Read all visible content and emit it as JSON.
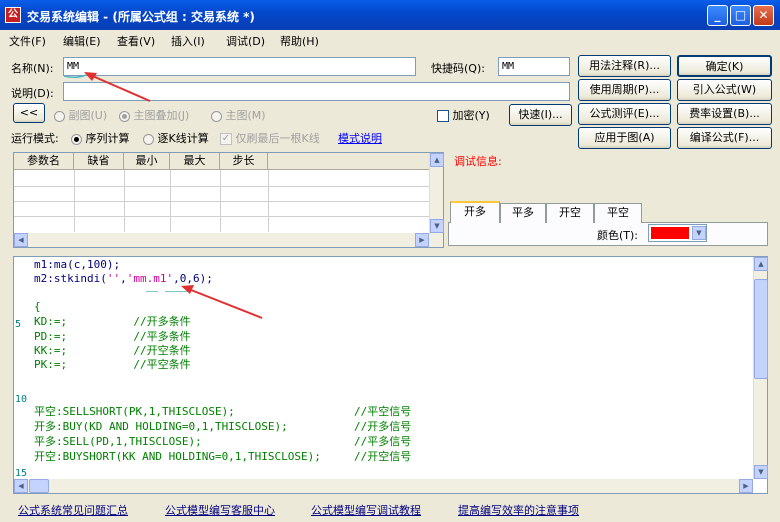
{
  "window": {
    "title": "交易系统编辑 - (所属公式组 : 交易系统 *)",
    "icon_text": "公"
  },
  "menu": [
    "文件(F)",
    "编辑(E)",
    "查看(V)",
    "插入(I)",
    "调试(D)",
    "帮助(H)"
  ],
  "form": {
    "name_label": "名称(N):",
    "name_value": "MM",
    "hotkey_label": "快捷码(Q):",
    "hotkey_value": "MM",
    "desc_label": "说明(D):",
    "desc_value": "",
    "collapse_btn": "<<",
    "radio_sub": "副图(U)",
    "radio_main_overlay": "主图叠加(J)",
    "radio_main": "主图(M)",
    "encrypt_label": "加密(Y)",
    "fast_btn": "快速(I)...",
    "run_mode_label": "运行模式:",
    "mode_seq": "序列计算",
    "mode_kline": "逐K线计算",
    "refresh_last": "仅刷最后一根K线",
    "mode_help": "模式说明"
  },
  "buttons": {
    "usage_note": "用法注释(R)...",
    "ok": "确定(K)",
    "use_period": "使用周期(P)...",
    "import_formula": "引入公式(W)",
    "formula_test": "公式测评(E)...",
    "fee_setting": "费率设置(B)...",
    "apply_chart": "应用于图(A)",
    "compile": "编译公式(F)..."
  },
  "params": {
    "headers": [
      "参数名",
      "缺省",
      "最小",
      "最大",
      "步长"
    ]
  },
  "debug": {
    "label": "调试信息:",
    "tabs": [
      "开多",
      "平多",
      "开空",
      "平空"
    ],
    "color_label": "颜色(T):",
    "color_value": "#ff0000"
  },
  "editor": {
    "line_numbers": [
      "5",
      "10",
      "15"
    ],
    "lines": [
      {
        "segs": [
          {
            "t": "m1:ma(c,100);",
            "c": "code"
          }
        ]
      },
      {
        "segs": [
          {
            "t": "m2:stkindi(",
            "c": "code"
          },
          {
            "t": "''",
            "c": "mag"
          },
          {
            "t": ",",
            "c": "code"
          },
          {
            "t": "'mm.m1'",
            "c": "mag"
          },
          {
            "t": ",0,6);",
            "c": "code"
          }
        ]
      },
      {
        "segs": []
      },
      {
        "segs": [
          {
            "t": "{",
            "c": "grn"
          }
        ]
      },
      {
        "segs": [
          {
            "t": "KD:=;          //开多条件",
            "c": "grn"
          }
        ]
      },
      {
        "segs": [
          {
            "t": "PD:=;          //平多条件",
            "c": "grn"
          }
        ]
      },
      {
        "segs": [
          {
            "t": "KK:=;          //开空条件",
            "c": "grn"
          }
        ]
      },
      {
        "segs": [
          {
            "t": "PK:=;          //平空条件",
            "c": "grn"
          }
        ]
      },
      {
        "segs": []
      },
      {
        "segs": []
      },
      {
        "segs": [
          {
            "t": "平空:SELLSHORT(PK,1,THISCLOSE);                  //平空信号",
            "c": "grn"
          }
        ]
      },
      {
        "segs": [
          {
            "t": "开多:BUY(KD AND HOLDING=0,1,THISCLOSE);          //开多信号",
            "c": "grn"
          }
        ]
      },
      {
        "segs": [
          {
            "t": "平多:SELL(PD,1,THISCLOSE);                       //平多信号",
            "c": "grn"
          }
        ]
      },
      {
        "segs": [
          {
            "t": "开空:BUYSHORT(KK AND HOLDING=0,1,THISCLOSE);     //开空信号",
            "c": "grn"
          }
        ]
      }
    ]
  },
  "footer_links": [
    "公式系统常见问题汇总",
    "公式模型编写客服中心",
    "公式模型编写调试教程",
    "提高编写效率的注意事项"
  ]
}
